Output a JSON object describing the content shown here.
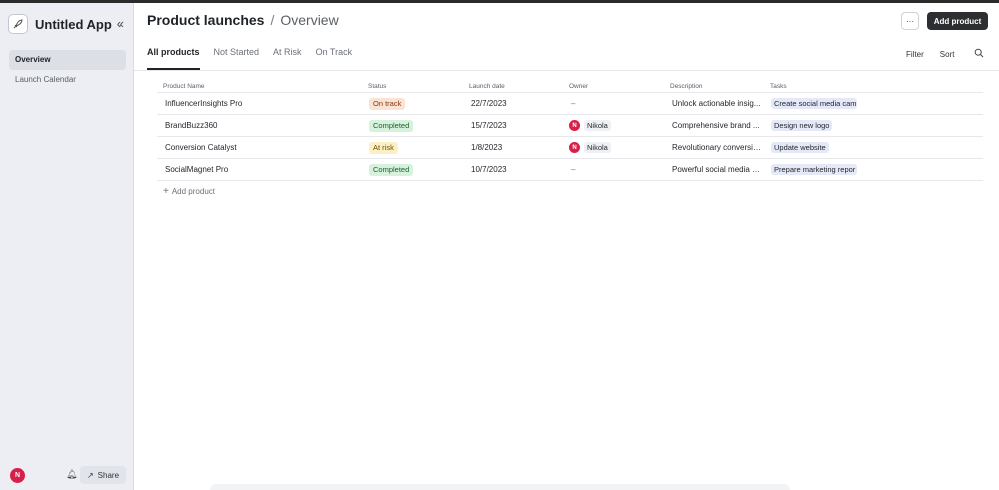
{
  "sidebar": {
    "app_name": "Untitled App",
    "nav": [
      {
        "label": "Overview",
        "active": true
      },
      {
        "label": "Launch Calendar",
        "active": false
      }
    ],
    "user_initial": "N",
    "share_label": "Share"
  },
  "header": {
    "title": "Product launches",
    "separator": "/",
    "subtitle": "Overview",
    "more_label": "···",
    "add_label": "Add product"
  },
  "tabs": [
    {
      "label": "All products",
      "active": true
    },
    {
      "label": "Not Started",
      "active": false
    },
    {
      "label": "At Risk",
      "active": false
    },
    {
      "label": "On Track",
      "active": false
    }
  ],
  "tools": {
    "filter": "Filter",
    "sort": "Sort"
  },
  "table": {
    "columns": [
      "Product Name",
      "Status",
      "Launch date",
      "Owner",
      "Description",
      "Tasks"
    ],
    "rows": [
      {
        "name": "InfluencerInsights Pro",
        "status": "On track",
        "date": "22/7/2023",
        "owner": "–",
        "owner_initial": "",
        "description": "Unlock actionable insig...",
        "task": "Create social media cam"
      },
      {
        "name": "BrandBuzz360",
        "status": "Completed",
        "date": "15/7/2023",
        "owner": "Nikola",
        "owner_initial": "N",
        "description": "Comprehensive brand ...",
        "task": "Design new logo"
      },
      {
        "name": "Conversion Catalyst",
        "status": "At risk",
        "date": "1/8/2023",
        "owner": "Nikola",
        "owner_initial": "N",
        "description": "Revolutionary conversio...",
        "task": "Update website"
      },
      {
        "name": "SocialMagnet Pro",
        "status": "Completed",
        "date": "10/7/2023",
        "owner": "–",
        "owner_initial": "",
        "description": "Powerful social media m...",
        "task": "Prepare marketing repor"
      }
    ],
    "add_label": "Add product"
  },
  "colors": {
    "accent_dark": "#2d2e31",
    "avatar": "#d6204a",
    "on_track": "#fbe3d3",
    "completed": "#d6f2dc",
    "at_risk": "#fcefc4"
  }
}
